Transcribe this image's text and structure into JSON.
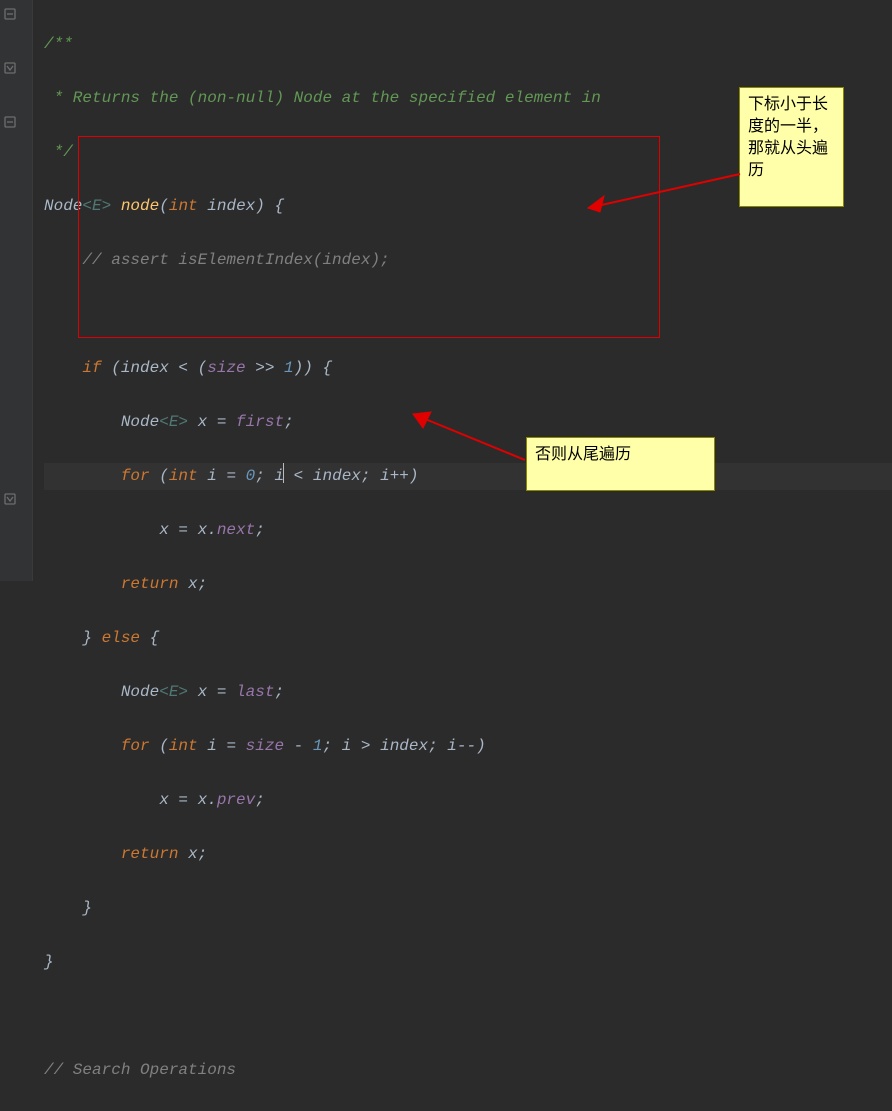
{
  "code": {
    "l1a": "/**",
    "l2a": " * Returns the (non-null) Node at the specified element in",
    "l3a": " */",
    "l4a": "Node",
    "l4b": "<E>",
    "l4c": " ",
    "l4d": "node",
    "l4e": "(",
    "l4f": "int",
    "l4g": " index) {",
    "l5a": "    ",
    "l5b": "// assert isElementIndex(index);",
    "l7a": "    ",
    "l7b": "if",
    "l7c": " (index < (",
    "l7d": "size",
    "l7e": " >> ",
    "l7f": "1",
    "l7g": ")) {",
    "l8a": "        Node",
    "l8b": "<E>",
    "l8c": " x = ",
    "l8d": "first",
    "l8e": ";",
    "l9a": "        ",
    "l9b": "for",
    "l9c": " (",
    "l9d": "int",
    "l9e": " i = ",
    "l9f": "0",
    "l9g": "; i",
    "l9h": " < index; i++)",
    "l10a": "            x = x.",
    "l10b": "next",
    "l10c": ";",
    "l11a": "        ",
    "l11b": "return",
    "l11c": " x;",
    "l12a": "    } ",
    "l12b": "else",
    "l12c": " {",
    "l13a": "        Node",
    "l13b": "<E>",
    "l13c": " x = ",
    "l13d": "last",
    "l13e": ";",
    "l14a": "        ",
    "l14b": "for",
    "l14c": " (",
    "l14d": "int",
    "l14e": " i = ",
    "l14f": "size",
    "l14g": " - ",
    "l14h": "1",
    "l14i": "; i > index; i--)",
    "l15a": "            x = x.",
    "l15b": "prev",
    "l15c": ";",
    "l16a": "        ",
    "l16b": "return",
    "l16c": " x;",
    "l17a": "    }",
    "l18a": "}",
    "l20a": "// Search Operations"
  },
  "notes": {
    "n1": "下标小于长度的一半，那就从头遍历",
    "n2": "否则从尾遍历"
  }
}
